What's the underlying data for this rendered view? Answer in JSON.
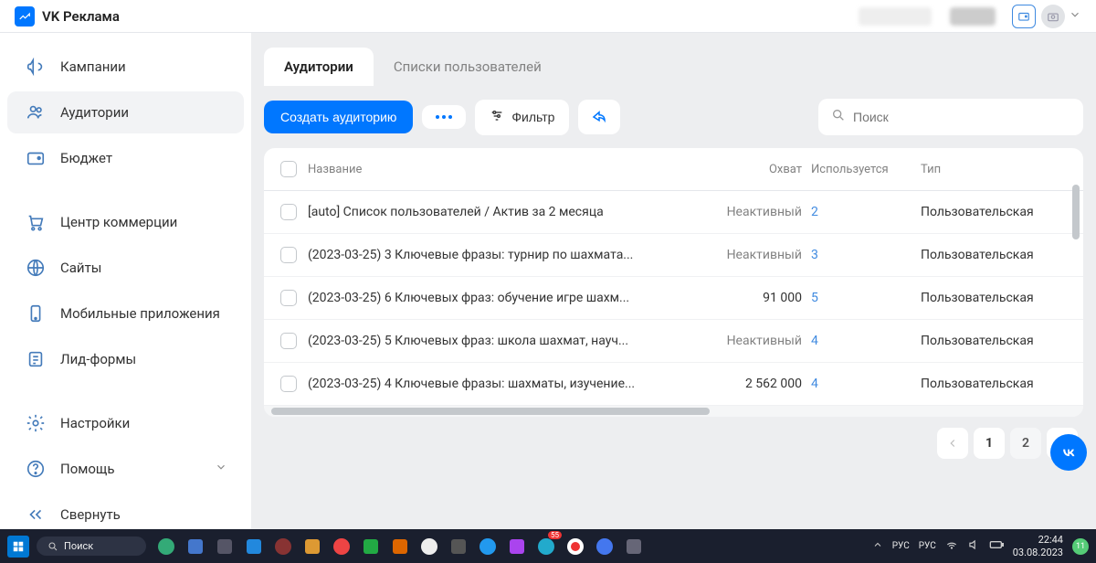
{
  "header": {
    "app_title": "VK Реклама"
  },
  "sidebar": {
    "items": [
      {
        "label": "Кампании"
      },
      {
        "label": "Аудитории"
      },
      {
        "label": "Бюджет"
      },
      {
        "label": "Центр коммерции"
      },
      {
        "label": "Сайты"
      },
      {
        "label": "Мобильные приложения"
      },
      {
        "label": "Лид-формы"
      },
      {
        "label": "Настройки"
      },
      {
        "label": "Помощь"
      },
      {
        "label": "Свернуть"
      }
    ]
  },
  "tabs": {
    "audiences": "Аудитории",
    "user_lists": "Списки пользователей"
  },
  "toolbar": {
    "create_label": "Создать аудиторию",
    "filter_label": "Фильтр",
    "search_placeholder": "Поиск"
  },
  "table": {
    "headers": {
      "name": "Название",
      "reach": "Охват",
      "used": "Используется",
      "type": "Тип"
    },
    "rows": [
      {
        "name": "[auto] Список пользователей / Актив за 2 месяца",
        "reach": "Неактивный",
        "reach_num": false,
        "used": "2",
        "type": "Пользовательская"
      },
      {
        "name": "(2023-03-25) 3 Ключевые фразы: турнир по шахмата...",
        "reach": "Неактивный",
        "reach_num": false,
        "used": "3",
        "type": "Пользовательская"
      },
      {
        "name": "(2023-03-25) 6 Ключевых фраз: обучение игре шахм...",
        "reach": "91 000",
        "reach_num": true,
        "used": "5",
        "type": "Пользовательская"
      },
      {
        "name": "(2023-03-25) 5 Ключевых фраз: школа шахмат, науч...",
        "reach": "Неактивный",
        "reach_num": false,
        "used": "4",
        "type": "Пользовательская"
      },
      {
        "name": "(2023-03-25) 4 Ключевые фразы: шахматы, изучение...",
        "reach": "2 562 000",
        "reach_num": true,
        "used": "4",
        "type": "Пользовательская"
      }
    ]
  },
  "pagination": {
    "page1": "1",
    "page2": "2"
  },
  "taskbar": {
    "search": "Поиск",
    "lang1": "РУС",
    "lang2": "РУС",
    "time": "22:44",
    "date": "03.08.2023",
    "notif": "11"
  }
}
